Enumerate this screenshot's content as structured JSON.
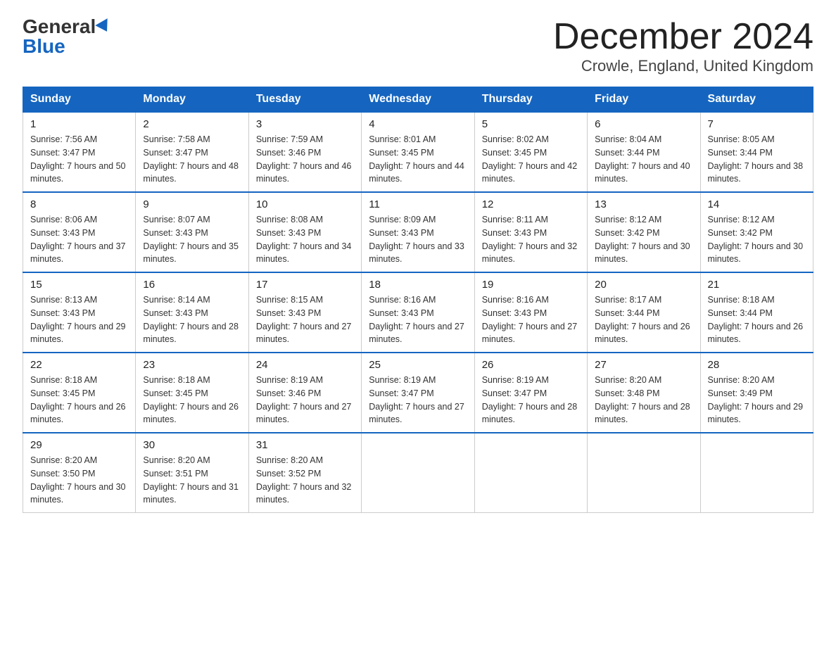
{
  "logo": {
    "general": "General",
    "blue": "Blue"
  },
  "header": {
    "title": "December 2024",
    "subtitle": "Crowle, England, United Kingdom"
  },
  "days_of_week": [
    "Sunday",
    "Monday",
    "Tuesday",
    "Wednesday",
    "Thursday",
    "Friday",
    "Saturday"
  ],
  "weeks": [
    [
      {
        "day": "1",
        "sunrise": "7:56 AM",
        "sunset": "3:47 PM",
        "daylight": "7 hours and 50 minutes."
      },
      {
        "day": "2",
        "sunrise": "7:58 AM",
        "sunset": "3:47 PM",
        "daylight": "7 hours and 48 minutes."
      },
      {
        "day": "3",
        "sunrise": "7:59 AM",
        "sunset": "3:46 PM",
        "daylight": "7 hours and 46 minutes."
      },
      {
        "day": "4",
        "sunrise": "8:01 AM",
        "sunset": "3:45 PM",
        "daylight": "7 hours and 44 minutes."
      },
      {
        "day": "5",
        "sunrise": "8:02 AM",
        "sunset": "3:45 PM",
        "daylight": "7 hours and 42 minutes."
      },
      {
        "day": "6",
        "sunrise": "8:04 AM",
        "sunset": "3:44 PM",
        "daylight": "7 hours and 40 minutes."
      },
      {
        "day": "7",
        "sunrise": "8:05 AM",
        "sunset": "3:44 PM",
        "daylight": "7 hours and 38 minutes."
      }
    ],
    [
      {
        "day": "8",
        "sunrise": "8:06 AM",
        "sunset": "3:43 PM",
        "daylight": "7 hours and 37 minutes."
      },
      {
        "day": "9",
        "sunrise": "8:07 AM",
        "sunset": "3:43 PM",
        "daylight": "7 hours and 35 minutes."
      },
      {
        "day": "10",
        "sunrise": "8:08 AM",
        "sunset": "3:43 PM",
        "daylight": "7 hours and 34 minutes."
      },
      {
        "day": "11",
        "sunrise": "8:09 AM",
        "sunset": "3:43 PM",
        "daylight": "7 hours and 33 minutes."
      },
      {
        "day": "12",
        "sunrise": "8:11 AM",
        "sunset": "3:43 PM",
        "daylight": "7 hours and 32 minutes."
      },
      {
        "day": "13",
        "sunrise": "8:12 AM",
        "sunset": "3:42 PM",
        "daylight": "7 hours and 30 minutes."
      },
      {
        "day": "14",
        "sunrise": "8:12 AM",
        "sunset": "3:42 PM",
        "daylight": "7 hours and 30 minutes."
      }
    ],
    [
      {
        "day": "15",
        "sunrise": "8:13 AM",
        "sunset": "3:43 PM",
        "daylight": "7 hours and 29 minutes."
      },
      {
        "day": "16",
        "sunrise": "8:14 AM",
        "sunset": "3:43 PM",
        "daylight": "7 hours and 28 minutes."
      },
      {
        "day": "17",
        "sunrise": "8:15 AM",
        "sunset": "3:43 PM",
        "daylight": "7 hours and 27 minutes."
      },
      {
        "day": "18",
        "sunrise": "8:16 AM",
        "sunset": "3:43 PM",
        "daylight": "7 hours and 27 minutes."
      },
      {
        "day": "19",
        "sunrise": "8:16 AM",
        "sunset": "3:43 PM",
        "daylight": "7 hours and 27 minutes."
      },
      {
        "day": "20",
        "sunrise": "8:17 AM",
        "sunset": "3:44 PM",
        "daylight": "7 hours and 26 minutes."
      },
      {
        "day": "21",
        "sunrise": "8:18 AM",
        "sunset": "3:44 PM",
        "daylight": "7 hours and 26 minutes."
      }
    ],
    [
      {
        "day": "22",
        "sunrise": "8:18 AM",
        "sunset": "3:45 PM",
        "daylight": "7 hours and 26 minutes."
      },
      {
        "day": "23",
        "sunrise": "8:18 AM",
        "sunset": "3:45 PM",
        "daylight": "7 hours and 26 minutes."
      },
      {
        "day": "24",
        "sunrise": "8:19 AM",
        "sunset": "3:46 PM",
        "daylight": "7 hours and 27 minutes."
      },
      {
        "day": "25",
        "sunrise": "8:19 AM",
        "sunset": "3:47 PM",
        "daylight": "7 hours and 27 minutes."
      },
      {
        "day": "26",
        "sunrise": "8:19 AM",
        "sunset": "3:47 PM",
        "daylight": "7 hours and 28 minutes."
      },
      {
        "day": "27",
        "sunrise": "8:20 AM",
        "sunset": "3:48 PM",
        "daylight": "7 hours and 28 minutes."
      },
      {
        "day": "28",
        "sunrise": "8:20 AM",
        "sunset": "3:49 PM",
        "daylight": "7 hours and 29 minutes."
      }
    ],
    [
      {
        "day": "29",
        "sunrise": "8:20 AM",
        "sunset": "3:50 PM",
        "daylight": "7 hours and 30 minutes."
      },
      {
        "day": "30",
        "sunrise": "8:20 AM",
        "sunset": "3:51 PM",
        "daylight": "7 hours and 31 minutes."
      },
      {
        "day": "31",
        "sunrise": "8:20 AM",
        "sunset": "3:52 PM",
        "daylight": "7 hours and 32 minutes."
      },
      null,
      null,
      null,
      null
    ]
  ]
}
